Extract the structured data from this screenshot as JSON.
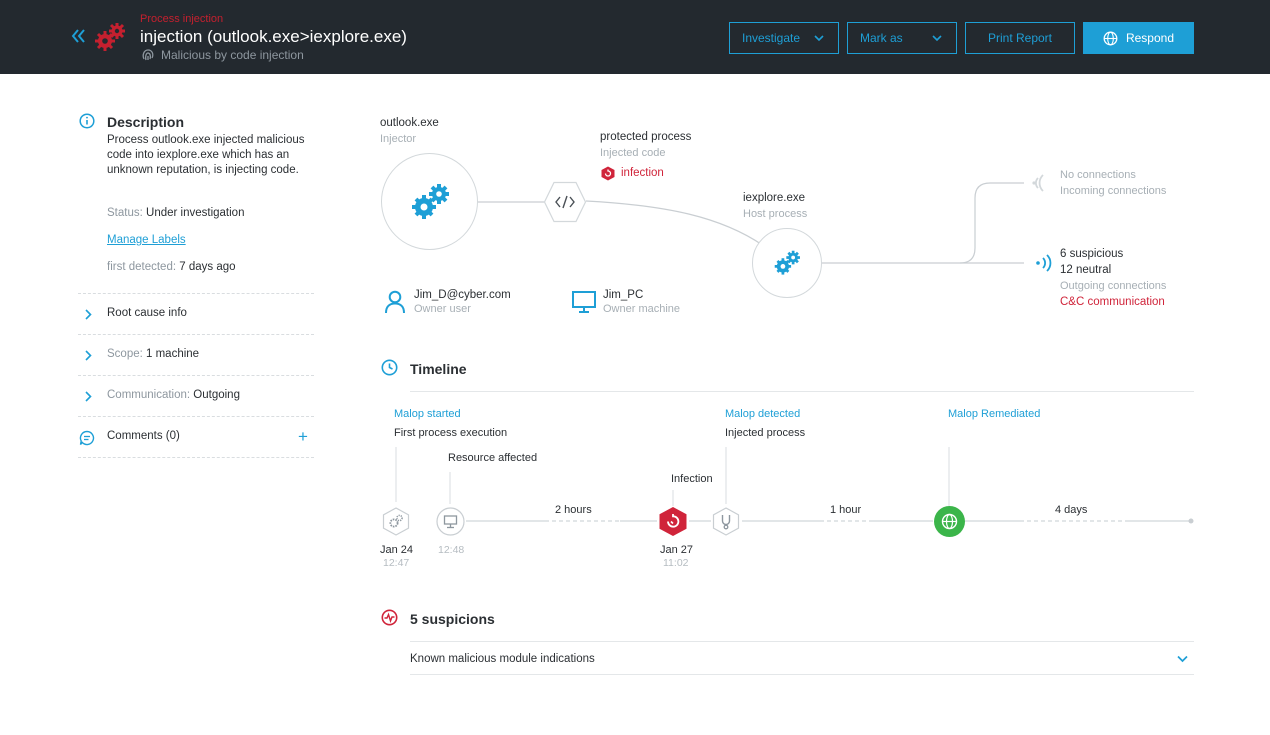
{
  "header": {
    "subtitle": "Process injection",
    "title": "injection (outlook.exe>iexplore.exe)",
    "meta": "Malicious by code injection",
    "buttons": {
      "investigate": "Investigate",
      "mark_as": "Mark as",
      "print_report": "Print Report",
      "respond": "Respond"
    }
  },
  "description": {
    "title": "Description",
    "text": "Process outlook.exe injected malicious code into iexplore.exe which has an  unknown reputation, is injecting code.",
    "status_label": "Status:",
    "status_value": "Under investigation",
    "manage_labels": "Manage Labels",
    "first_detected_label": "first detected:",
    "first_detected_value": "7 days ago"
  },
  "sidebar_rows": {
    "root_cause": "Root cause info",
    "scope_label": "Scope:",
    "scope_value": "1 machine",
    "comm_label": "Communication:",
    "comm_value": "Outgoing",
    "comments": "Comments (0)",
    "add_icon": "+"
  },
  "graph": {
    "injector_name": "outlook.exe",
    "injector_role": "Injector",
    "protected_title": "protected process",
    "protected_sub": "Injected code",
    "infection": "infection",
    "host_name": "iexplore.exe",
    "host_role": "Host process",
    "no_conn": "No connections",
    "incoming_conn": "Incoming connections",
    "suspicious": "6 suspicious",
    "neutral": "12 neutral",
    "outgoing_conn": "Outgoing connections",
    "cnc": "C&C communication",
    "user_name": "Jim_D@cyber.com",
    "user_role": "Owner user",
    "machine_name": "Jim_PC",
    "machine_role": "Owner machine"
  },
  "timeline": {
    "title": "Timeline",
    "malop_started": "Malop started",
    "first_exec": "First process execution",
    "resource_affected": "Resource affected",
    "infection": "Infection",
    "malop_detected": "Malop detected",
    "injected_process": "Injected process",
    "malop_remediated": "Malop Remediated",
    "dur_1": "2 hours",
    "dur_2": "1 hour",
    "dur_3": "4 days",
    "date_1": "Jan 24",
    "time_1": "12:47",
    "time_2": "12:48",
    "date_2": "Jan 27",
    "time_3": "11:02"
  },
  "suspicions": {
    "title": "5 suspicions",
    "item_1": "Known malicious module indications"
  },
  "colors": {
    "accent": "#1e9fd6",
    "danger": "#d0243a",
    "success": "#3bb54a",
    "header_bg": "#23292f"
  }
}
